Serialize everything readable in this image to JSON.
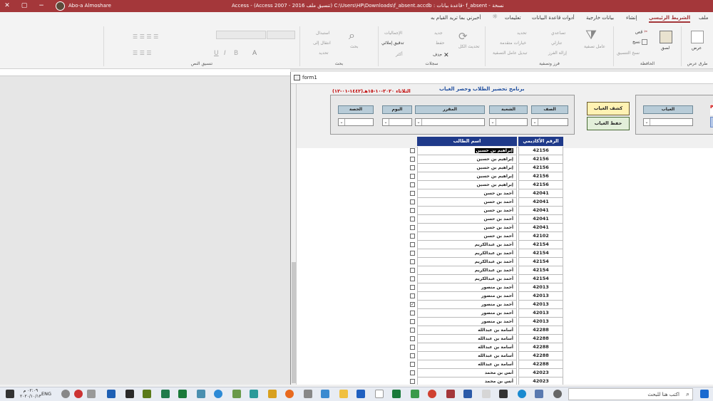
{
  "titlebar": {
    "user": "Abo-a Almoshare",
    "title": "Access  -  (Access 2007 - 2016 تنسيق ملف) C:\\Users\\HP\\Downloads\\f_absent.accdb : قاعدة بيانات- f_absent - نسخة",
    "controls": [
      "−",
      "▢",
      "✕"
    ]
  },
  "tabs": [
    {
      "label": "ملف"
    },
    {
      "label": "الشريط الرئيسي",
      "active": true
    },
    {
      "label": "إنشاء"
    },
    {
      "label": "بيانات خارجية"
    },
    {
      "label": "أدوات قاعدة البيانات"
    },
    {
      "label": "تعليمات"
    },
    {
      "label": "أخبرني بما تريد القيام به"
    }
  ],
  "ribbon": {
    "groups": {
      "views": "طرق عرض",
      "clipboard": "الحافظة",
      "sort": "فرز وتصفية",
      "records": "سجلات",
      "find": "بحث",
      "text": "تنسيق النص"
    },
    "buttons": {
      "view": "عرض",
      "paste": "لصق",
      "cut": "قص",
      "copy": "نسخ",
      "format_painter": "نسخ التنسيق",
      "filter": "عامل تصفية",
      "ascending": "تصاعدي",
      "descending": "تنازلي",
      "remove_sort": "إزالة الفرز",
      "selection": "تحديد",
      "advanced": "خيارات متقدمة",
      "toggle_filter": "تبديل عامل التصفية",
      "refresh": "تحديث الكل",
      "new": "جديد",
      "save": "حفظ",
      "delete": "حذف",
      "totals": "الإجماليات",
      "spelling": "تدقيق إملائي",
      "more": "أكثر",
      "find": "بحث",
      "replace": "استبدال",
      "goto": "انتقال إلى",
      "select": "تحديد"
    }
  },
  "form": {
    "window_title": "form1",
    "app_title": "برنامج تحضير الطلاب وحصر الغياب",
    "date": "الثلاثاء ٢٠٢٠-١٠-١٥هـ(١٤٤٢-٠١-١٢)",
    "filters": {
      "grade": "الصف",
      "section": "الشعبة",
      "course": "المقرر",
      "day": "اليوم",
      "period": "الحصة"
    },
    "absence_label": "الغياب",
    "btn_report": "كشف الغياب",
    "btn_save": "حفظ الغياب",
    "pdf": "PD",
    "columns": {
      "id": "الرقم الأكاديمي",
      "name": "اسم الطالب"
    },
    "rows": [
      {
        "id": "42156",
        "name": "إبراهيم بن حسين",
        "checked": false,
        "sel": true
      },
      {
        "id": "42156",
        "name": "إبراهيم بن حسين",
        "checked": false
      },
      {
        "id": "42156",
        "name": "إبراهيم بن حسين",
        "checked": false
      },
      {
        "id": "42156",
        "name": "إبراهيم بن حسين",
        "checked": false
      },
      {
        "id": "42156",
        "name": "إبراهيم بن حسين",
        "checked": false
      },
      {
        "id": "42041",
        "name": "أحمد بن حسن",
        "checked": false
      },
      {
        "id": "42041",
        "name": "أحمد بن حسن",
        "checked": false
      },
      {
        "id": "42041",
        "name": "أحمد بن حسن",
        "checked": false
      },
      {
        "id": "42041",
        "name": "أحمد بن حسن",
        "checked": false
      },
      {
        "id": "42041",
        "name": "أحمد بن حسن",
        "checked": false
      },
      {
        "id": "42102",
        "name": "أحمد بن حسن",
        "checked": false
      },
      {
        "id": "42154",
        "name": "أحمد بن عبدالكريم",
        "checked": false
      },
      {
        "id": "42154",
        "name": "أحمد بن عبدالكريم",
        "checked": false
      },
      {
        "id": "42154",
        "name": "أحمد بن عبدالكريم",
        "checked": false
      },
      {
        "id": "42154",
        "name": "أحمد بن عبدالكريم",
        "checked": false
      },
      {
        "id": "42154",
        "name": "أحمد بن عبدالكريم",
        "checked": false
      },
      {
        "id": "42013",
        "name": "أحمد بن منصور",
        "checked": false
      },
      {
        "id": "42013",
        "name": "أحمد بن منصور",
        "checked": false
      },
      {
        "id": "42013",
        "name": "أحمد بن منصور",
        "checked": true
      },
      {
        "id": "42013",
        "name": "أحمد بن منصور",
        "checked": false
      },
      {
        "id": "42013",
        "name": "أحمد بن منصور",
        "checked": false
      },
      {
        "id": "42288",
        "name": "أسامة بن عبدالله",
        "checked": false
      },
      {
        "id": "42288",
        "name": "أسامة بن عبدالله",
        "checked": false
      },
      {
        "id": "42288",
        "name": "أسامة بن عبدالله",
        "checked": false
      },
      {
        "id": "42288",
        "name": "أسامة بن عبدالله",
        "checked": false
      },
      {
        "id": "42288",
        "name": "أسامة بن عبدالله",
        "checked": false
      },
      {
        "id": "42023",
        "name": "أنس بن محمد",
        "checked": false
      },
      {
        "id": "42023",
        "name": "أنس بن محمد",
        "checked": false
      }
    ]
  },
  "taskbar": {
    "search_placeholder": "اكتب هنا للبحث",
    "time": "٠٢:٠٩ م",
    "date": "٢٠٢٠/١٠/١٣",
    "lang": "ENG"
  },
  "colors": {
    "accent": "#a4373a",
    "header_blue": "#1f3a8a"
  }
}
